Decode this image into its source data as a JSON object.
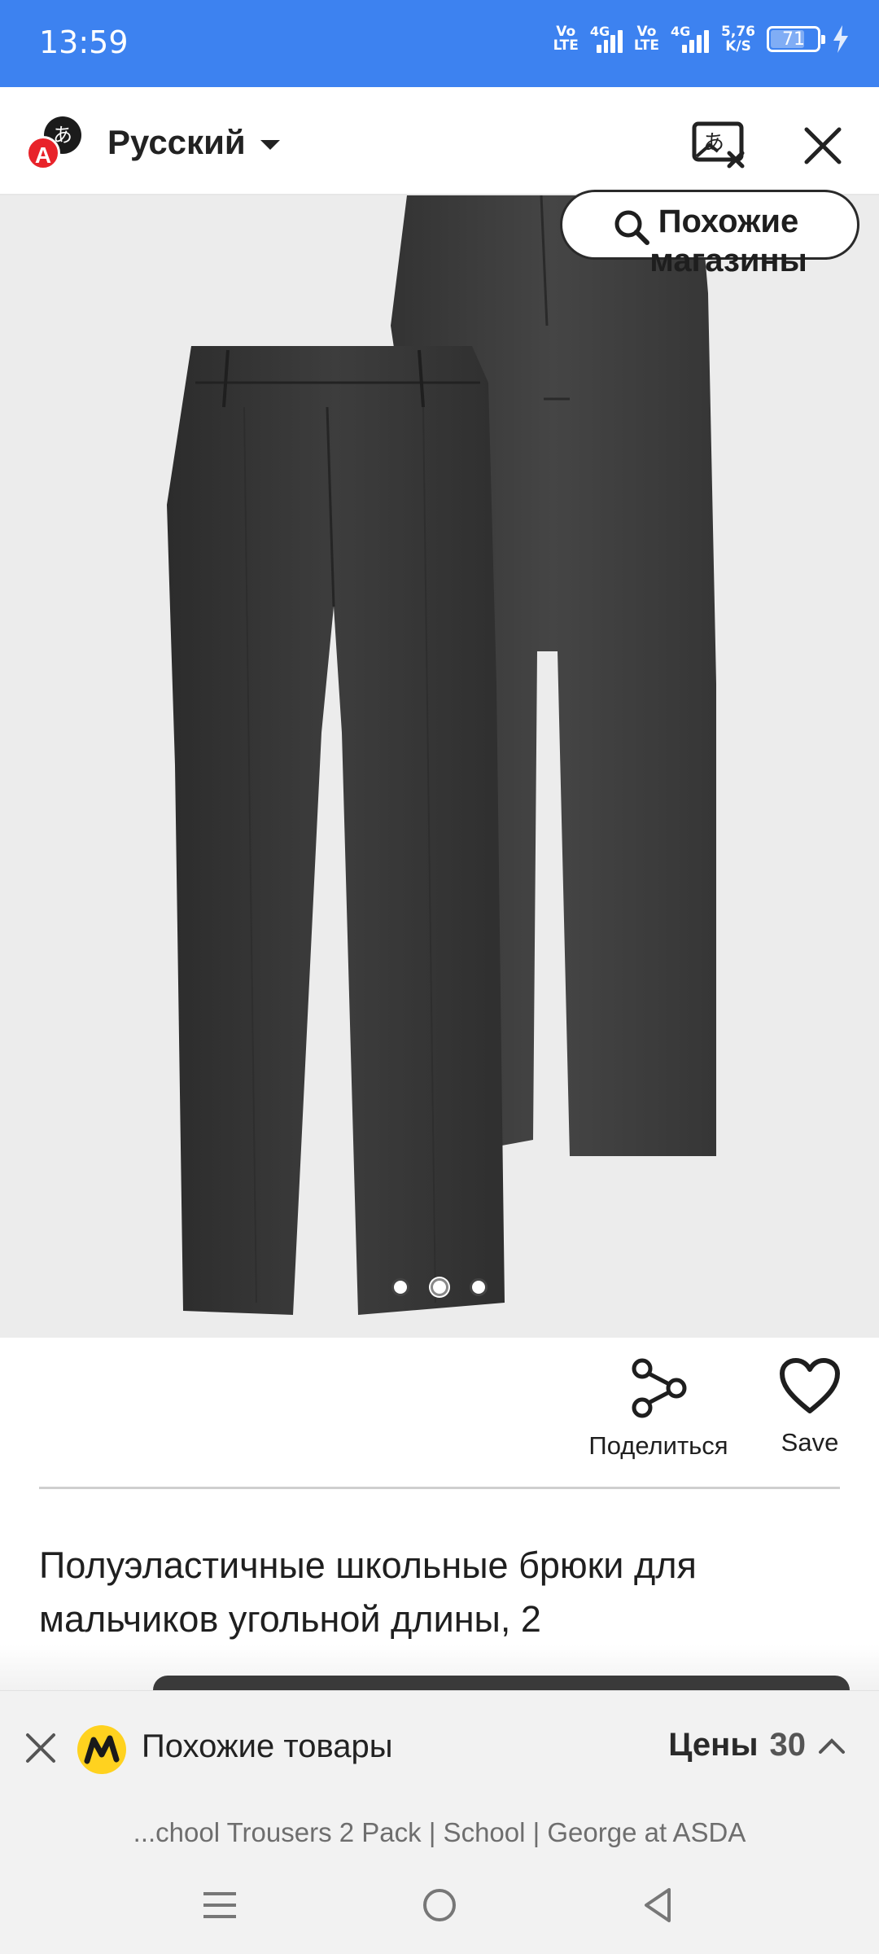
{
  "status_bar": {
    "time": "13:59",
    "volte1": [
      "Vo",
      "LTE"
    ],
    "sig1_label": "4G",
    "volte2": [
      "Vo",
      "LTE"
    ],
    "sig2_label": "4G",
    "speed": [
      "5,76",
      "K/S"
    ],
    "battery": "71"
  },
  "header": {
    "logo_glyph": "あ",
    "logo_letter": "A",
    "language": "Русский",
    "icons": [
      "translate-image-icon",
      "close-icon"
    ]
  },
  "image": {
    "similar_shops_label": "Похожие магазины",
    "carousel": {
      "count": 3,
      "active_index": 1
    }
  },
  "actions": {
    "share_label": "Поделиться",
    "save_label": "Save"
  },
  "product": {
    "title": "Полуэластичные школьные брюки для мальчиков угольной длины, 2"
  },
  "similar_bar": {
    "title": "Похожие товары",
    "prices_label": "Цены",
    "prices_count": "30"
  },
  "url": "...chool Trousers 2 Pack | School | George at ASDA",
  "colors": {
    "status_bar": "#3d82f0",
    "accent_red": "#e8232a",
    "market_yellow": "#ffd21f"
  }
}
